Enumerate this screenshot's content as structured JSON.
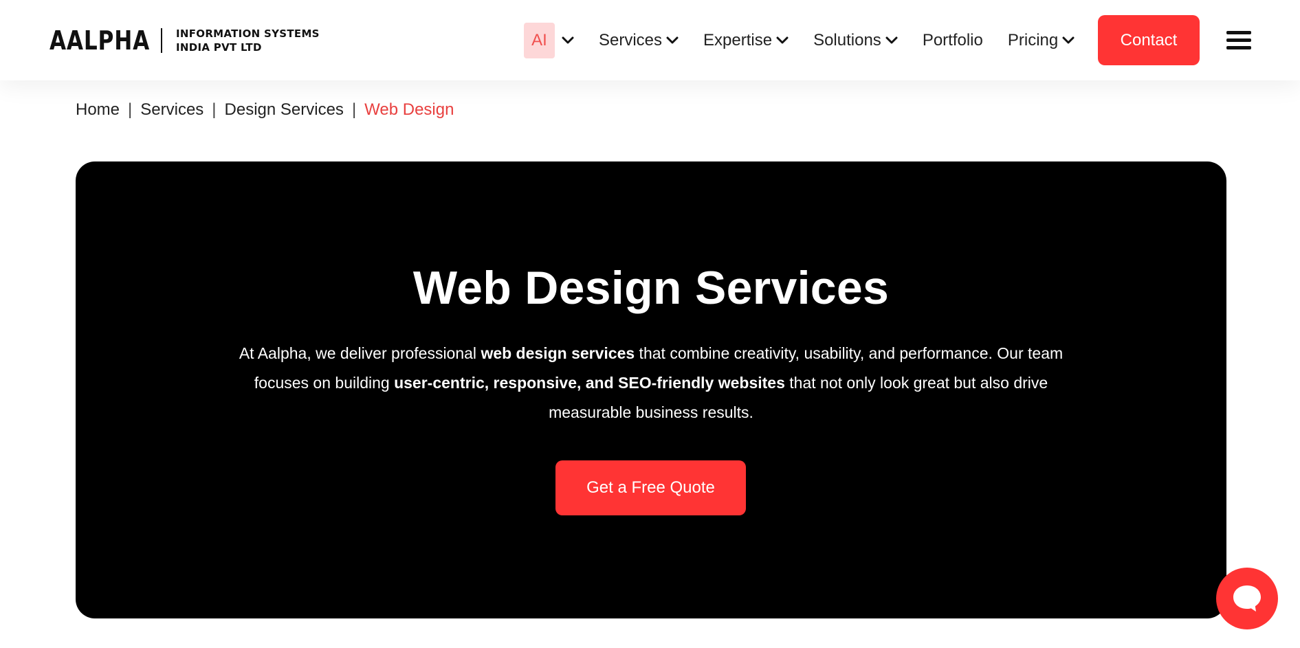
{
  "logo": {
    "wordmark": "AALPHA",
    "tagline_line1": "INFORMATION SYSTEMS",
    "tagline_line2": "INDIA PVT LTD"
  },
  "nav": {
    "ai_label": "AI",
    "items": [
      {
        "label": "Services",
        "has_dropdown": true
      },
      {
        "label": "Expertise",
        "has_dropdown": true
      },
      {
        "label": "Solutions",
        "has_dropdown": true
      },
      {
        "label": "Portfolio",
        "has_dropdown": false
      },
      {
        "label": "Pricing",
        "has_dropdown": true
      }
    ],
    "contact_label": "Contact",
    "menu_icon": "hamburger-icon"
  },
  "breadcrumb": {
    "items": [
      "Home",
      "Services",
      "Design Services"
    ],
    "current": "Web Design",
    "separator": "|"
  },
  "hero": {
    "title": "Web Design Services",
    "desc_part1": "At Aalpha, we deliver professional ",
    "desc_bold1": "web design services",
    "desc_part2": " that combine creativity, usability, and performance. Our team focuses on building ",
    "desc_bold2": "user-centric, responsive, and SEO-friendly websites",
    "desc_part3": " that not only look great but also drive measurable business results.",
    "cta_label": "Get a Free Quote"
  },
  "chat": {
    "icon": "chat-bubble-icon"
  },
  "colors": {
    "accent": "#ff3434",
    "ai_badge_bg": "#fdd7d8",
    "ai_badge_text": "#f0504f",
    "breadcrumb_current": "#e8403f",
    "hero_bg": "#000000"
  }
}
